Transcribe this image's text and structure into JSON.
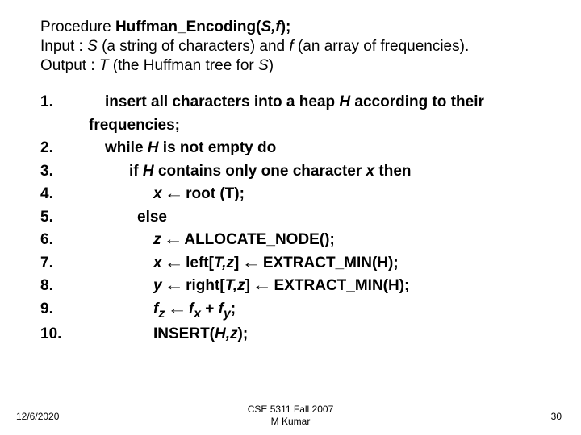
{
  "header": {
    "proc_label": "Procedure ",
    "proc_name": "Huffman_Encoding(",
    "proc_args": "S,f",
    "proc_close": ");",
    "input_label": "Input : ",
    "input_s": "S",
    "input_mid1": " (a string of characters) and ",
    "input_f": "f",
    "input_mid2": " (an array of frequencies).",
    "output_label": "Output : ",
    "output_t": "T",
    "output_rest": " (the Huffman tree for ",
    "output_s": "S",
    "output_close": ")"
  },
  "nums": {
    "n1": "1.",
    "n2": "2.",
    "n3": "3.",
    "n4": "4.",
    "n5": "5.",
    "n6": "6.",
    "n7": "7.",
    "n8": "8.",
    "n9": "9.",
    "n10": "10."
  },
  "step1": {
    "a": "insert all characters into a heap ",
    "h": "H",
    "b": " according to their frequencies;"
  },
  "step2": {
    "a": "while ",
    "h": "H",
    "b": " is not empty do"
  },
  "step3": {
    "a": "if  ",
    "h": "H",
    "b": " contains only one character ",
    "x": "x",
    "c": " then"
  },
  "step4": {
    "x": "x",
    "b": " root (T);"
  },
  "step5": {
    "a": "else"
  },
  "step6": {
    "z": "z",
    "b": " ALLOCATE_NODE();"
  },
  "step7": {
    "x": "x",
    "b": " left[",
    "tz": "T,z",
    "c": "] ",
    "d": " EXTRACT_MIN(H);"
  },
  "step8": {
    "y": "y",
    "b": " right[",
    "tz": "T,z",
    "c": "] ",
    "d": " EXTRACT_MIN(H);"
  },
  "step9": {
    "fz": "f",
    "z": "z",
    "fx": "f",
    "x": "x",
    "plus": " + ",
    "fy": "f",
    "y": "y",
    "semi": ";"
  },
  "step10": {
    "a": "INSERT(",
    "hz": "H,z",
    "b": ");"
  },
  "arrow": "←",
  "footer": {
    "date": "12/6/2020",
    "center1": "CSE 5311 Fall 2007",
    "center2": "M Kumar",
    "page": "30"
  }
}
